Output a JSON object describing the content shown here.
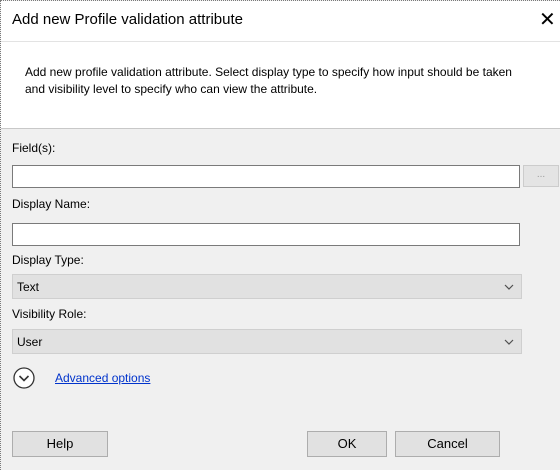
{
  "dialog": {
    "title": "Add new Profile validation attribute",
    "close_glyph": "✕",
    "description": "Add new profile validation attribute. Select display type to specify how input should be taken and visibility level to specify who can view the attribute."
  },
  "form": {
    "fields_label": "Field(s):",
    "fields_value": "",
    "browse_label": "...",
    "display_name_label": "Display Name:",
    "display_name_value": "",
    "display_type_label": "Display Type:",
    "display_type_value": "Text",
    "visibility_role_label": "Visibility Role:",
    "visibility_role_value": "User",
    "advanced_options_label": "Advanced options"
  },
  "buttons": {
    "help": "Help",
    "ok": "OK",
    "cancel": "Cancel"
  }
}
